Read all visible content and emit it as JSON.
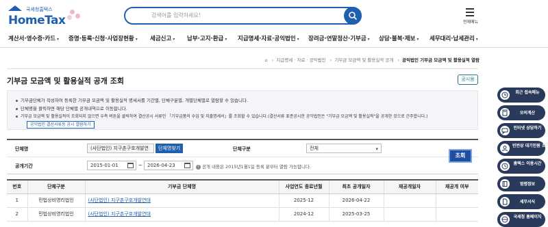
{
  "header": {
    "logo_sub": "국세청홈택스",
    "logo_main": "HomeTax",
    "search_placeholder": "검색어를 입력하세요!",
    "menu_all_label": "전체메뉴"
  },
  "gnb": [
    "계산서·영수증·카드",
    "증명·등록·신청·사업장현황",
    "세금신고",
    "납부·고지·환급",
    "지급명세·자료·공익법인",
    "장려금·연말정산·기부금",
    "상담·불복·제보",
    "세무대리·납세관리"
  ],
  "breadcrumb": [
    "지급명세 · 자료 · 공익법인",
    "기부금 모금액 및 활용실적 공개",
    "공익법인 기부금 모금액 및 활용실적 열람"
  ],
  "page": {
    "title": "기부금 모금액 및 활용실적 공개 조회",
    "notice_button": "공시용"
  },
  "info": {
    "lines": [
      "기부금단체가 작성하여 등록한 기부금 모금액 및 활용실적 명세서를 기간별, 단체구분별, 개별단체별로 열람할 수 있습니다.",
      "단체명을 클릭하면 해당 단체별 공개내역으로 이동합니다.",
      "기부금 모금액 및 활용실적이 조회되지 않으면 우측 버튼을 클릭하여 결산공시 서류인 「기부금품의 수입 및 지출명세서」를 조회할 수 있습니다.(결산서류 표준공시한 공익법인은 \"기부금 모금액 및 활용실적\"을 공개한 것으로 간주합니다.)"
    ],
    "link_button": "공익법인 결산서류등 공시 열람하기"
  },
  "form": {
    "org_label": "단체명",
    "org_value": "(사단법인) 지구촌구호개발연",
    "org_tag": "단체명찾기",
    "type_label": "단체구분",
    "type_value": "전체",
    "period_label": "공개기간",
    "start_date": "2015-01-01",
    "tilde": "~",
    "end_date": "2026-04-23",
    "period_note": "공개 내용은 2015년1월1일 등록 분부터 열람 가능합니다.",
    "inquiry_button": "조회"
  },
  "table": {
    "headers": [
      "번호",
      "단체구분",
      "기부금 단체명",
      "사업연도 종료년월",
      "최초 공개일자",
      "재공개일자",
      "재공개 여부"
    ],
    "rows": [
      [
        "1",
        "민법상비영리법인",
        "(사단법인) 지구촌구호개발연대",
        "2025-12",
        "2026-04-22",
        "",
        ""
      ],
      [
        "2",
        "민법상비영리법인",
        "(사단법인) 지구촌구호개발연대",
        "2024-12",
        "2025-03-25",
        "",
        ""
      ]
    ]
  },
  "quick_menu": [
    "최근 접속메뉴",
    "모의계산",
    "인터넷 상담하기",
    "빈번상 대기인원 조회",
    "홈택스 이용시간",
    "범령정보",
    "세무서식",
    "국세청 홈페이지"
  ],
  "colors": {
    "brand": "#1f5fae",
    "side": "#2a3a5a",
    "accent_btn": "#1f4fa0"
  }
}
